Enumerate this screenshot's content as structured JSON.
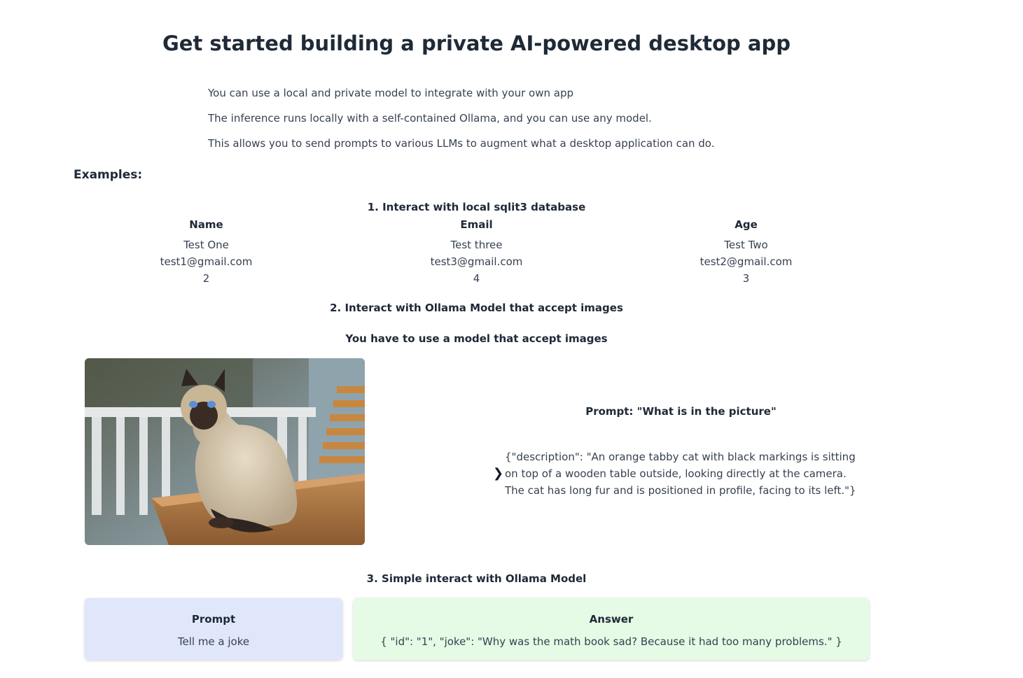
{
  "header": {
    "title": "Get started building a private AI-powered desktop app"
  },
  "intro": {
    "lines": [
      "You can use a local and private model to integrate with your own app",
      "The inference runs locally with a self-contained Ollama, and you can use any model.",
      "This allows you to send prompts to various LLMs to augment what a desktop application can do."
    ]
  },
  "examples": {
    "heading": "Examples:"
  },
  "section1": {
    "title": "1. Interact with local sqlit3 database",
    "columns": [
      {
        "header": "Name",
        "cells": [
          "Test One",
          "test1@gmail.com",
          "2"
        ]
      },
      {
        "header": "Email",
        "cells": [
          "Test three",
          "test3@gmail.com",
          "4"
        ]
      },
      {
        "header": "Age",
        "cells": [
          "Test Two",
          "test2@gmail.com",
          "3"
        ]
      }
    ]
  },
  "section2": {
    "title": "2. Interact with Ollama Model that accept images",
    "subtitle": "You have to use a model that accept images",
    "prompt": "Prompt: \"What is in the picture\"",
    "answer": "{\"description\": \"An orange tabby cat with black markings is sitting on top of a wooden table outside, looking directly at the camera. The cat has long fur and is positioned in profile, facing to its left.\"}"
  },
  "section3": {
    "title": "3. Simple interact with Ollama Model",
    "prompt_label": "Prompt",
    "prompt_text": "Tell me a joke",
    "answer_label": "Answer",
    "answer_text": "{ \"id\": \"1\", \"joke\": \"Why was the math book sad? Because it had too many problems.\" }"
  },
  "colors": {
    "prompt_card_bg": "#e1e7fb",
    "answer_card_bg": "#e5fbe5",
    "text_dark": "#1f2937"
  }
}
